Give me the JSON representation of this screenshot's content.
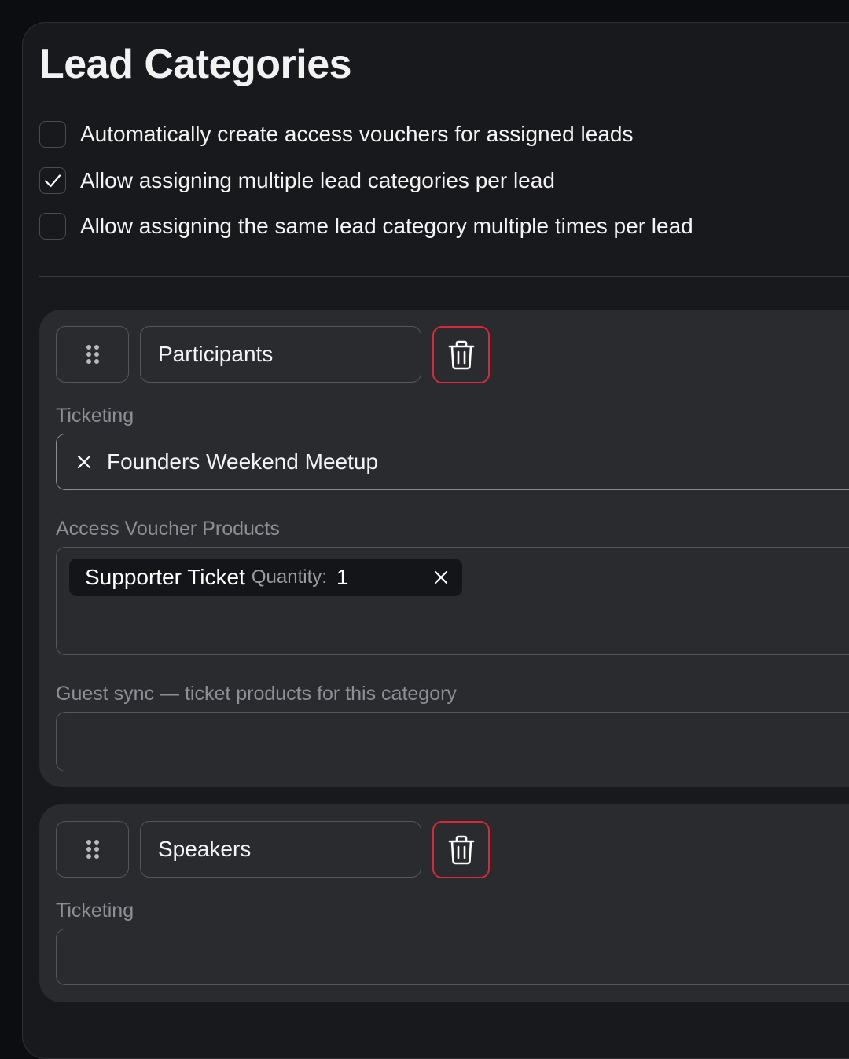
{
  "page": {
    "title": "Lead Categories"
  },
  "options": [
    {
      "label": "Automatically create access vouchers for assigned leads",
      "checked": false
    },
    {
      "label": "Allow assigning multiple lead categories per lead",
      "checked": true
    },
    {
      "label": "Allow assigning the same lead category multiple times per lead",
      "checked": false
    }
  ],
  "categories": [
    {
      "name": "Participants",
      "ticketing_label": "Ticketing",
      "ticketing_value": "Founders Weekend Meetup",
      "vouchers_label": "Access Voucher Products",
      "vouchers": [
        {
          "product": "Supporter Ticket",
          "quantity_label": "Quantity:",
          "quantity": "1"
        }
      ],
      "guest_sync_label": "Guest sync — ticket products for this category",
      "guest_sync_value": ""
    },
    {
      "name": "Speakers",
      "ticketing_label": "Ticketing",
      "ticketing_value": ""
    }
  ],
  "icons": {
    "drag": "drag-handle-icon",
    "delete": "trash-icon",
    "remove": "close-icon",
    "check": "checkmark-icon"
  },
  "colors": {
    "background": "#0c0d10",
    "panel": "#18191c",
    "card": "#2a2b2f",
    "danger": "#d8293a",
    "muted_text": "#8e8f95"
  }
}
